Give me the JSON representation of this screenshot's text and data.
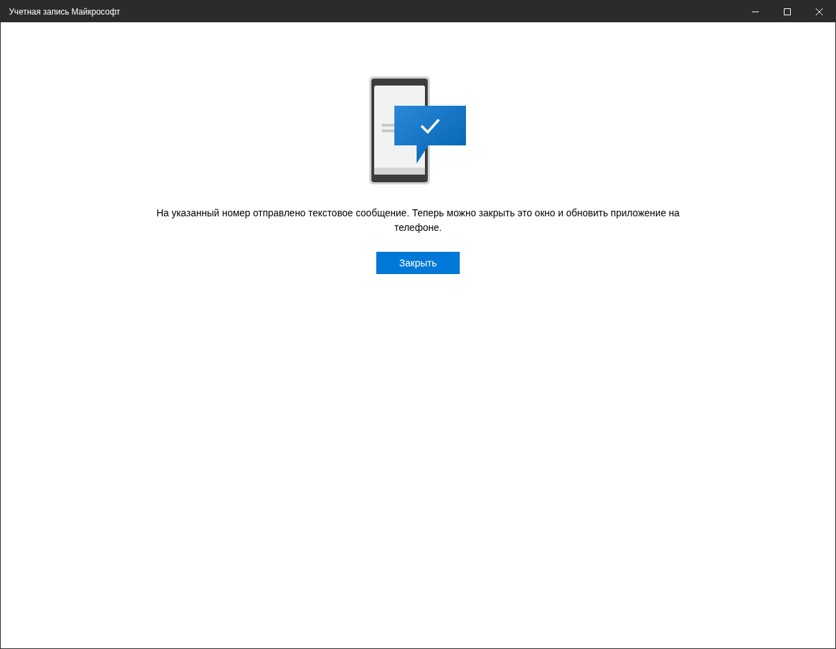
{
  "window": {
    "title": "Учетная запись Майкрософт"
  },
  "message": "На указанный номер отправлено текстовое сообщение. Теперь можно закрыть это окно и обновить приложение на телефоне.",
  "button": {
    "label": "Закрыть"
  }
}
